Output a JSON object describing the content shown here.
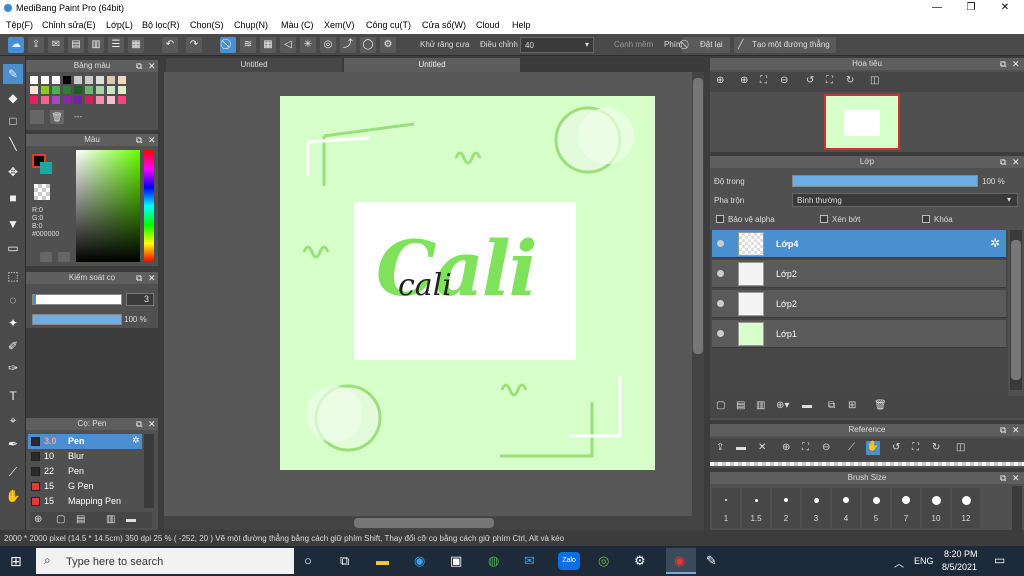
{
  "app": {
    "title": "MediBang Paint Pro (64bit)"
  },
  "window_controls": {
    "minimize": "—",
    "maximize": "❐",
    "close": "✕"
  },
  "menu": [
    "Tệp(F)",
    "Chỉnh sửa(E)",
    "Lớp(L)",
    "Bộ lọc(R)",
    "Chọn(S)",
    "Chụp(N)",
    "Màu (C)",
    "Xem(V)",
    "Công cụ(T)",
    "Cửa sổ(W)",
    "Cloud",
    "Help"
  ],
  "toolbar": {
    "antialias_label": "Khử răng cưa",
    "adjust_label": "Điều chỉnh",
    "adjust_value": "40",
    "curve_label": "Cạnh mềm",
    "key_label": "Phím",
    "reset_label": "Đặt lại",
    "line_label": "Tạo một đường thẳng"
  },
  "tabs": [
    "Untitled",
    "Untitled"
  ],
  "palette": {
    "title": "Bảng màu",
    "footer": "---",
    "swatches": [
      "#ffffff",
      "#ffffff",
      "#ffffff",
      "#000000",
      "#cccccc",
      "#cccccc",
      "#e0e0e0",
      "#d9c8b0",
      "#f0d8c0",
      "#f4e4d4",
      "#8ac926",
      "#4caf50",
      "#2e7d32",
      "#1b5e20",
      "#66bb6a",
      "#a5d6a7",
      "#c8e6c9",
      "#dcedc8",
      "#e91e63",
      "#f06292",
      "#ab47bc",
      "#8e24aa",
      "#7b1fa2",
      "#d81b60",
      "#f48fb1",
      "#f8bbd0",
      "#ff4081"
    ]
  },
  "color": {
    "title": "Màu",
    "rgb": [
      "R:0",
      "G:0",
      "B:0"
    ],
    "hex": "#000000",
    "fg": "#000000",
    "bg": "#ffffff"
  },
  "brush_control": {
    "title": "Kiểm soát cọ",
    "size": "3",
    "opacity": "100 %"
  },
  "brush_list": {
    "title": "Cọ: Pen",
    "items": [
      {
        "size": "3.0",
        "name": "Pen",
        "color": "#2a2a2a"
      },
      {
        "size": "10",
        "name": "Blur",
        "color": "#2a2a2a"
      },
      {
        "size": "22",
        "name": "Pen",
        "color": "#2a2a2a"
      },
      {
        "size": "15",
        "name": "G Pen",
        "color": "#e53935"
      },
      {
        "size": "15",
        "name": "Mapping Pen",
        "color": "#e53935"
      }
    ]
  },
  "navigator": {
    "title": "Hoa tiêu"
  },
  "layers": {
    "title": "Lớp",
    "opacity_label": "Độ trong",
    "opacity_value": "100 %",
    "opacity": 1.0,
    "blend_label": "Pha trộn",
    "blend_value": "Bình thường",
    "protect_alpha": "Bảo vệ alpha",
    "clip": "Xén bớt",
    "lock": "Khóa",
    "items": [
      "Lớp4",
      "Lớp2",
      "Lớp2",
      "Lớp1"
    ]
  },
  "reference": {
    "title": "Reference"
  },
  "brush_size": {
    "title": "Brush Size",
    "sizes": [
      "1",
      "1.5",
      "2",
      "3",
      "4",
      "5",
      "7",
      "10",
      "12"
    ]
  },
  "status": {
    "text": "2000 * 2000 pixel  (14.5 * 14.5cm)  350 dpi  25 %  ( -252, 20 )  Vẽ một đường thẳng bằng cách giữ phím Shift, Thay đổi cỡ cọ bằng cách giữ phím Ctrl, Alt và kéo"
  },
  "artwork": {
    "script_text": "Cali",
    "cursive_text": "cali"
  },
  "taskbar": {
    "search_placeholder": "Type here to search",
    "lang": "ENG",
    "time": "8:20 PM",
    "date": "8/5/2021",
    "zalo": "Zalo"
  }
}
